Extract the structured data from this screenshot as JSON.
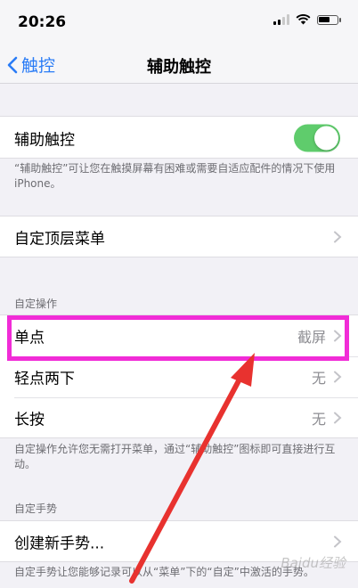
{
  "status_bar": {
    "time": "20:26"
  },
  "nav": {
    "back_label": "触控",
    "title": "辅助触控"
  },
  "assistive_touch": {
    "label": "辅助触控",
    "enabled": true,
    "footnote": "“辅助触控”可让您在触摸屏幕有困难或需要自适应配件的情况下使用iPhone。"
  },
  "top_menu": {
    "label": "自定顶层菜单"
  },
  "custom_actions": {
    "header": "自定操作",
    "items": [
      {
        "label": "单点",
        "value": "截屏"
      },
      {
        "label": "轻点两下",
        "value": "无"
      },
      {
        "label": "长按",
        "value": "无"
      }
    ],
    "footnote": "自定操作允许您无需打开菜单，通过“辅助触控”图标即可直接进行互动。"
  },
  "custom_gestures": {
    "header": "自定手势",
    "create_label": "创建新手势...",
    "footnote": "自定手势让您能够记录可以从“菜单”下的“自定”中激活的手势。"
  },
  "annotation": {
    "highlight_color": "#f12cd7",
    "arrow_color": "#e8322f"
  },
  "watermark": "Baidu经验"
}
